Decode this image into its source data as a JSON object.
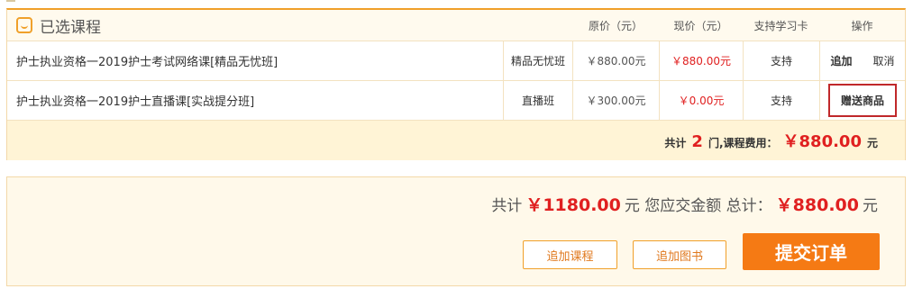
{
  "header": {
    "title": "已选课程",
    "col_original_price": "原价（元）",
    "col_current_price": "现价（元）",
    "col_study_card": "支持学习卡",
    "col_operation": "操作"
  },
  "courses": [
    {
      "name": "护士执业资格一2019护士考试网络课[精品无忧班]",
      "type": "精品无忧班",
      "original_price": "￥880.00元",
      "current_price": "￥880.00元",
      "study_card": "支持",
      "actions": [
        "追加",
        "取消"
      ]
    },
    {
      "name": "护士执业资格一2019护士直播课[实战提分班]",
      "type": "直播班",
      "original_price": "￥300.00元",
      "current_price": "￥0.00元",
      "study_card": "支持",
      "gift_label": "赠送商品"
    }
  ],
  "course_total": {
    "prefix": "共计",
    "count": "2",
    "middle": "门,课程费用：",
    "amount": "￥880.00",
    "suffix": "元"
  },
  "summary": {
    "prefix": "共计",
    "total": "￥1180.00",
    "middle": "元 您应交金额 总计：",
    "payable": "￥880.00",
    "suffix": "元"
  },
  "buttons": {
    "add_course": "追加课程",
    "add_book": "追加图书",
    "submit": "提交订单"
  },
  "colors": {
    "accent": "#f0a02a",
    "price_red": "#e02020",
    "submit_orange": "#f57a14"
  }
}
